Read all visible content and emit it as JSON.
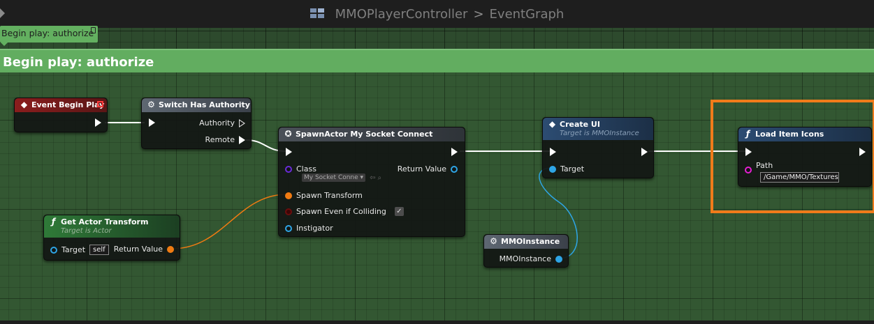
{
  "title_bar": {
    "crumbs": [
      "MMOPlayerController",
      "EventGraph"
    ],
    "separator": ">"
  },
  "comment": {
    "bubble_label": "Begin play: authorize",
    "header_label": "Begin play: authorize",
    "color": "#62ad60"
  },
  "nodes": {
    "event_begin_play": {
      "title": "Event Begin Play",
      "color": "#8a1d1d"
    },
    "switch_has_authority": {
      "title": "Switch Has Authority",
      "authority_label": "Authority",
      "remote_label": "Remote",
      "color": "#5b6470"
    },
    "spawn_actor": {
      "title": "SpawnActor My Socket Connect",
      "class_label": "Class",
      "class_value": "My Socket Conne",
      "return_label": "Return Value",
      "spawn_transform_label": "Spawn Transform",
      "spawn_even_label": "Spawn Even if Colliding",
      "instigator_label": "Instigator",
      "color": "#454b55"
    },
    "get_actor_transform": {
      "title": "Get Actor Transform",
      "subtitle": "Target is Actor",
      "target_label": "Target",
      "target_value": "self",
      "return_label": "Return Value",
      "color": "#2f7a38"
    },
    "create_ui": {
      "title": "Create UI",
      "subtitle": "Target is MMOInstance",
      "target_label": "Target",
      "color": "#2a4a6e"
    },
    "mmo_instance": {
      "title": "MMOInstance",
      "output_label": "MMOInstance",
      "color": "#5b6470"
    },
    "load_item_icons": {
      "title": "Load Item Icons",
      "path_label": "Path",
      "path_value": "/Game/MMO/Textures",
      "color": "#2a4a6e"
    }
  },
  "highlight_color": "#f07b1a"
}
